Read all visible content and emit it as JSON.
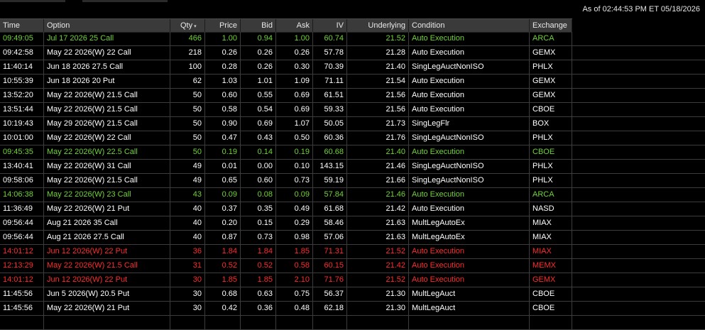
{
  "as_of": "As of 02:44:53 PM ET 05/18/2026",
  "columns": [
    {
      "key": "time",
      "label": "Time"
    },
    {
      "key": "option",
      "label": "Option"
    },
    {
      "key": "qty",
      "label": "Qty"
    },
    {
      "key": "price",
      "label": "Price"
    },
    {
      "key": "bid",
      "label": "Bid"
    },
    {
      "key": "ask",
      "label": "Ask"
    },
    {
      "key": "iv",
      "label": "IV"
    },
    {
      "key": "underlying",
      "label": "Underlying"
    },
    {
      "key": "condition",
      "label": "Condition"
    },
    {
      "key": "exchange",
      "label": "Exchange"
    }
  ],
  "sort_indicator": "▾",
  "colors": {
    "green": "#6fd436",
    "red": "#ff2b2b",
    "white": "#ffffff",
    "header_bg": "#3a3a3a",
    "grid_line": "#3c3c3c"
  },
  "rows": [
    {
      "color": "green",
      "time": "09:49:05",
      "option": "Jul 17 2026 25 Call",
      "qty": "466",
      "price": "1.00",
      "bid": "0.94",
      "ask": "1.00",
      "iv": "60.74",
      "underlying": "21.52",
      "condition": "Auto Execution",
      "exchange": "ARCA"
    },
    {
      "color": "white",
      "time": "09:42:58",
      "option": "May 22 2026(W) 22 Call",
      "qty": "218",
      "price": "0.26",
      "bid": "0.26",
      "ask": "0.26",
      "iv": "57.78",
      "underlying": "21.28",
      "condition": "Auto Execution",
      "exchange": "GEMX"
    },
    {
      "color": "white",
      "time": "11:40:14",
      "option": "Jun 18 2026 27.5 Call",
      "qty": "100",
      "price": "0.28",
      "bid": "0.26",
      "ask": "0.30",
      "iv": "70.39",
      "underlying": "21.40",
      "condition": "SingLegAuctNonISO",
      "exchange": "PHLX"
    },
    {
      "color": "white",
      "time": "10:55:39",
      "option": "Jun 18 2026 20 Put",
      "qty": "62",
      "price": "1.03",
      "bid": "1.01",
      "ask": "1.09",
      "iv": "71.11",
      "underlying": "21.54",
      "condition": "Auto Execution",
      "exchange": "GEMX"
    },
    {
      "color": "white",
      "time": "13:52:20",
      "option": "May 22 2026(W) 21.5 Call",
      "qty": "50",
      "price": "0.60",
      "bid": "0.55",
      "ask": "0.69",
      "iv": "61.51",
      "underlying": "21.56",
      "condition": "Auto Execution",
      "exchange": "GEMX"
    },
    {
      "color": "white",
      "time": "13:51:44",
      "option": "May 22 2026(W) 21.5 Call",
      "qty": "50",
      "price": "0.58",
      "bid": "0.54",
      "ask": "0.69",
      "iv": "59.33",
      "underlying": "21.56",
      "condition": "Auto Execution",
      "exchange": "CBOE"
    },
    {
      "color": "white",
      "time": "10:19:43",
      "option": "May 29 2026(W) 21.5 Call",
      "qty": "50",
      "price": "0.90",
      "bid": "0.69",
      "ask": "1.07",
      "iv": "50.05",
      "underlying": "21.73",
      "condition": "SingLegFlr",
      "exchange": "BOX"
    },
    {
      "color": "white",
      "time": "10:01:00",
      "option": "May 22 2026(W) 22 Call",
      "qty": "50",
      "price": "0.47",
      "bid": "0.43",
      "ask": "0.50",
      "iv": "60.36",
      "underlying": "21.76",
      "condition": "SingLegAuctNonISO",
      "exchange": "PHLX"
    },
    {
      "color": "green",
      "time": "09:45:35",
      "option": "May 22 2026(W) 22.5 Call",
      "qty": "50",
      "price": "0.19",
      "bid": "0.14",
      "ask": "0.19",
      "iv": "60.68",
      "underlying": "21.40",
      "condition": "Auto Execution",
      "exchange": "CBOE"
    },
    {
      "color": "white",
      "time": "13:40:41",
      "option": "May 22 2026(W) 31 Call",
      "qty": "49",
      "price": "0.01",
      "bid": "0.00",
      "ask": "0.10",
      "iv": "143.15",
      "underlying": "21.46",
      "condition": "SingLegAuctNonISO",
      "exchange": "PHLX"
    },
    {
      "color": "white",
      "time": "09:58:06",
      "option": "May 22 2026(W) 21.5 Call",
      "qty": "49",
      "price": "0.65",
      "bid": "0.60",
      "ask": "0.73",
      "iv": "59.19",
      "underlying": "21.66",
      "condition": "SingLegAuctNonISO",
      "exchange": "PHLX"
    },
    {
      "color": "green",
      "time": "14:06:38",
      "option": "May 22 2026(W) 23 Call",
      "qty": "43",
      "price": "0.09",
      "bid": "0.08",
      "ask": "0.09",
      "iv": "57.84",
      "underlying": "21.46",
      "condition": "Auto Execution",
      "exchange": "ARCA"
    },
    {
      "color": "white",
      "time": "11:36:49",
      "option": "May 22 2026(W) 21 Put",
      "qty": "40",
      "price": "0.37",
      "bid": "0.35",
      "ask": "0.49",
      "iv": "61.68",
      "underlying": "21.42",
      "condition": "Auto Execution",
      "exchange": "NASD"
    },
    {
      "color": "white",
      "time": "09:56:44",
      "option": "Aug 21 2026 35 Call",
      "qty": "40",
      "price": "0.20",
      "bid": "0.15",
      "ask": "0.29",
      "iv": "58.46",
      "underlying": "21.63",
      "condition": "MultLegAutoEx",
      "exchange": "MIAX"
    },
    {
      "color": "white",
      "time": "09:56:44",
      "option": "Aug 21 2026 27.5 Call",
      "qty": "40",
      "price": "0.87",
      "bid": "0.73",
      "ask": "0.98",
      "iv": "57.06",
      "underlying": "21.63",
      "condition": "MultLegAutoEx",
      "exchange": "MIAX"
    },
    {
      "color": "red",
      "time": "14:01:12",
      "option": "Jun 12 2026(W) 22 Put",
      "qty": "36",
      "price": "1.84",
      "bid": "1.84",
      "ask": "1.85",
      "iv": "71.31",
      "underlying": "21.52",
      "condition": "Auto Execution",
      "exchange": "MIAX"
    },
    {
      "color": "red",
      "time": "12:13:29",
      "option": "May 22 2026(W) 21.5 Call",
      "qty": "31",
      "price": "0.52",
      "bid": "0.52",
      "ask": "0.58",
      "iv": "60.15",
      "underlying": "21.42",
      "condition": "Auto Execution",
      "exchange": "MEMX"
    },
    {
      "color": "red",
      "time": "14:01:12",
      "option": "Jun 12 2026(W) 22 Put",
      "qty": "30",
      "price": "1.85",
      "bid": "1.85",
      "ask": "2.10",
      "iv": "71.76",
      "underlying": "21.52",
      "condition": "Auto Execution",
      "exchange": "GEMX"
    },
    {
      "color": "white",
      "time": "11:45:56",
      "option": "Jun 5 2026(W) 20.5 Put",
      "qty": "30",
      "price": "0.68",
      "bid": "0.63",
      "ask": "0.75",
      "iv": "56.37",
      "underlying": "21.30",
      "condition": "MultLegAuct",
      "exchange": "CBOE"
    },
    {
      "color": "white",
      "time": "11:45:56",
      "option": "May 22 2026(W) 21 Put",
      "qty": "30",
      "price": "0.42",
      "bid": "0.36",
      "ask": "0.48",
      "iv": "62.18",
      "underlying": "21.30",
      "condition": "MultLegAuct",
      "exchange": "CBOE"
    }
  ]
}
